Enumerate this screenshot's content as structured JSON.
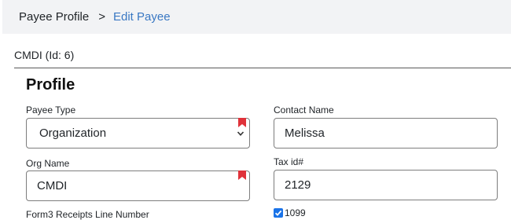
{
  "breadcrumb": {
    "root": "Payee Profile",
    "separator": ">",
    "current": "Edit Payee"
  },
  "record_heading": "CMDI (Id: 6)",
  "section_title": "Profile",
  "fields": {
    "payee_type": {
      "label": "Payee Type",
      "value": "Organization",
      "required": true
    },
    "contact_name": {
      "label": "Contact Name",
      "value": "Melissa"
    },
    "org_name": {
      "label": "Org Name",
      "value": "CMDI",
      "required": true
    },
    "tax_id": {
      "label": "Tax id#",
      "value": "2129"
    },
    "form3_receipts_line_number": {
      "label": "Form3 Receipts Line Number"
    },
    "is_1099": {
      "label": "1099",
      "checked": true
    }
  },
  "icons": {
    "required": "bookmark-flag-icon",
    "dropdown": "chevron-down-icon",
    "check": "checkmark-icon"
  },
  "colors": {
    "breadcrumb_bg": "#f2f3f5",
    "link": "#3a78c3",
    "required_flag": "#e0323a",
    "checkbox": "#1a73e8"
  }
}
